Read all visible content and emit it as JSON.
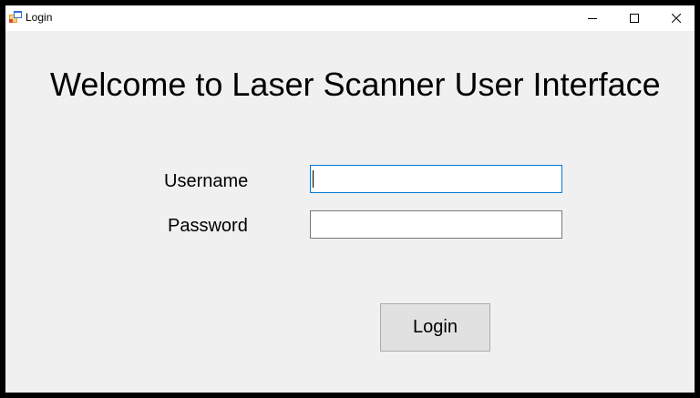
{
  "window": {
    "title": "Login",
    "app_icon": "winforms-app-icon",
    "controls": {
      "minimize_icon": "minimize-icon",
      "maximize_icon": "maximize-icon",
      "close_icon": "close-icon"
    }
  },
  "form": {
    "heading": "Welcome to Laser Scanner User Interface",
    "username_label": "Username",
    "username_value": "",
    "password_label": "Password",
    "password_value": "",
    "login_button_label": "Login"
  },
  "colors": {
    "focus_border": "#0078d7",
    "window_background": "#f0f0f0",
    "button_background": "#e1e1e1"
  }
}
